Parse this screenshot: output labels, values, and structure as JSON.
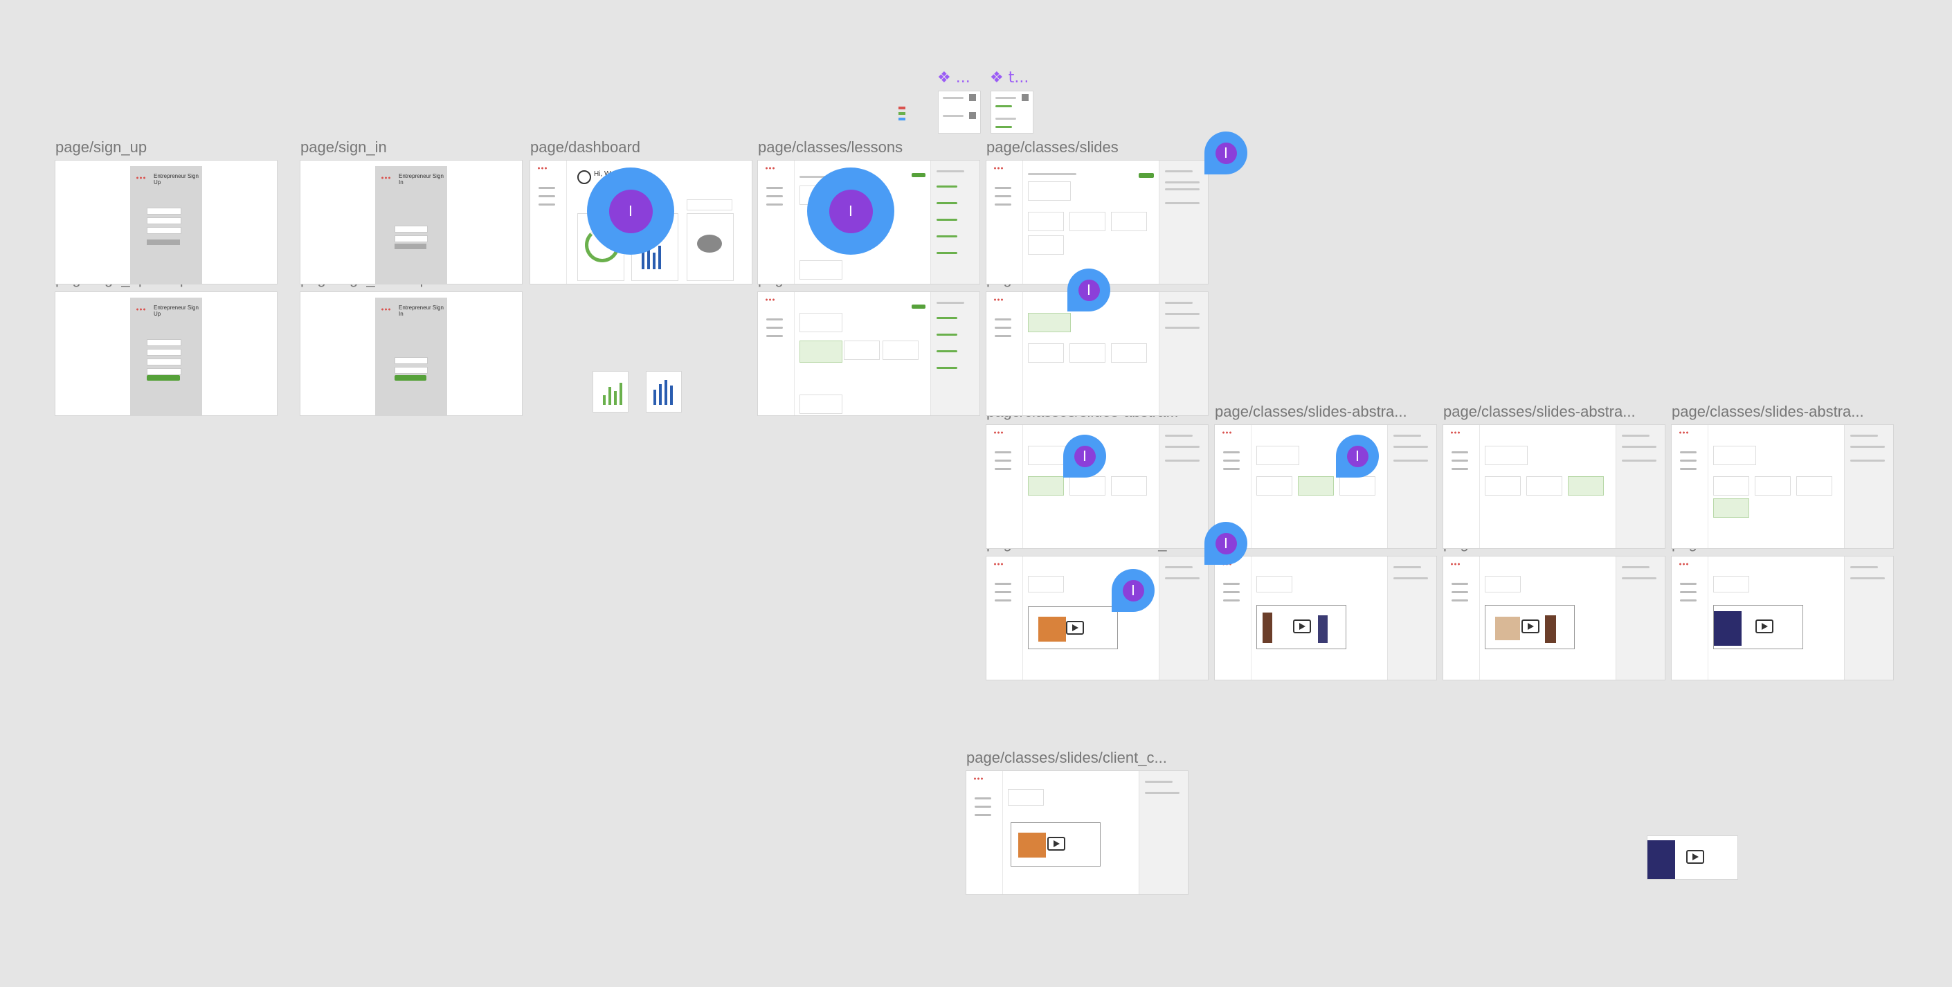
{
  "canvas": {
    "labels": {
      "sign_up": "page/sign_up",
      "sign_in": "page/sign_in",
      "dashboard": "page/dashboard",
      "lessons_1": "page/classes/lessons",
      "slides": "page/classes/slides",
      "sign_up_completed": "page/sign_up/completed",
      "sign_in_completed": "page/sign_in/completed",
      "lessons_2": "page/classes/lessons",
      "slides_abstract_1": "page/classes/slides-abstra...",
      "slides_abstract_2": "page/classes/slides-abstra...",
      "slides_abstract_3": "page/classes/slides-abstra...",
      "slides_abstract_4": "page/classes/slides-abstra...",
      "slides_abstract_5": "page/classes/slides-abstra...",
      "client_c_1": "page/classes/slides/client_c...",
      "unlocking": "page/classes/slides/unlocki...",
      "community": "page/classes/slides/commu...",
      "benefit": "page/classes/slides/benefit...",
      "client_c_2": "page/classes/slides/client_c..."
    },
    "components": {
      "comp_1": "❖ ...",
      "comp_2": "❖ t..."
    },
    "frames": {
      "sign_up_title": "Entrepreneur Sign Up",
      "sign_in_title": "Entrepreneur Sign In",
      "dashboard_greeting": "Hi, W"
    },
    "cursor_glyph": "I",
    "colors": {
      "background": "#e5e5e5",
      "accent_green": "#56a13a",
      "cursor_blue": "#4a9cf5",
      "cursor_purple": "#8b3fd9",
      "component_purple": "#9b5cf5"
    }
  }
}
